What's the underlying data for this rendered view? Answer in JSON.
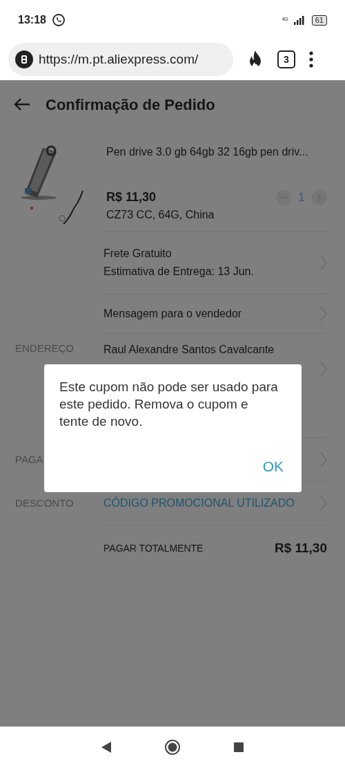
{
  "status_bar": {
    "time": "13:18",
    "network": "4G",
    "battery": "61"
  },
  "browser": {
    "url": "https://m.pt.aliexpress.com/",
    "tab_count": "3"
  },
  "page": {
    "title": "Confirmação de Pedido",
    "product": {
      "name": "Pen drive 3.0 gb 64gb 32 16gb pen driv...",
      "price": "R$ 11,30",
      "variant": "CZ73 CC,  64G,  China",
      "quantity": "1"
    },
    "rows": [
      {
        "kind": "shipping",
        "lines": [
          "Frete Gratuito",
          "Estimativa de Entrega: 13 Jun."
        ]
      },
      {
        "kind": "message",
        "lines": [
          "Mensagem para o vendedor"
        ]
      },
      {
        "kind": "address",
        "label": "ENDEREÇO",
        "lines": [
          "Raul Alexandre Santos Cavalcante"
        ]
      },
      {
        "kind": "payment",
        "label": "PAGA",
        "lines": []
      },
      {
        "kind": "discount",
        "label": "DESCONTO",
        "lines": [
          "CÓDIGO PROMOCIONAL UTILIZADO"
        ]
      }
    ],
    "total": {
      "label": "PAGAR TOTALMENTE",
      "amount": "R$ 11,30"
    }
  },
  "dialog": {
    "message": "Este cupom não pode ser usado para este pedido. Remova o cupom e tente de novo.",
    "button": "OK"
  }
}
